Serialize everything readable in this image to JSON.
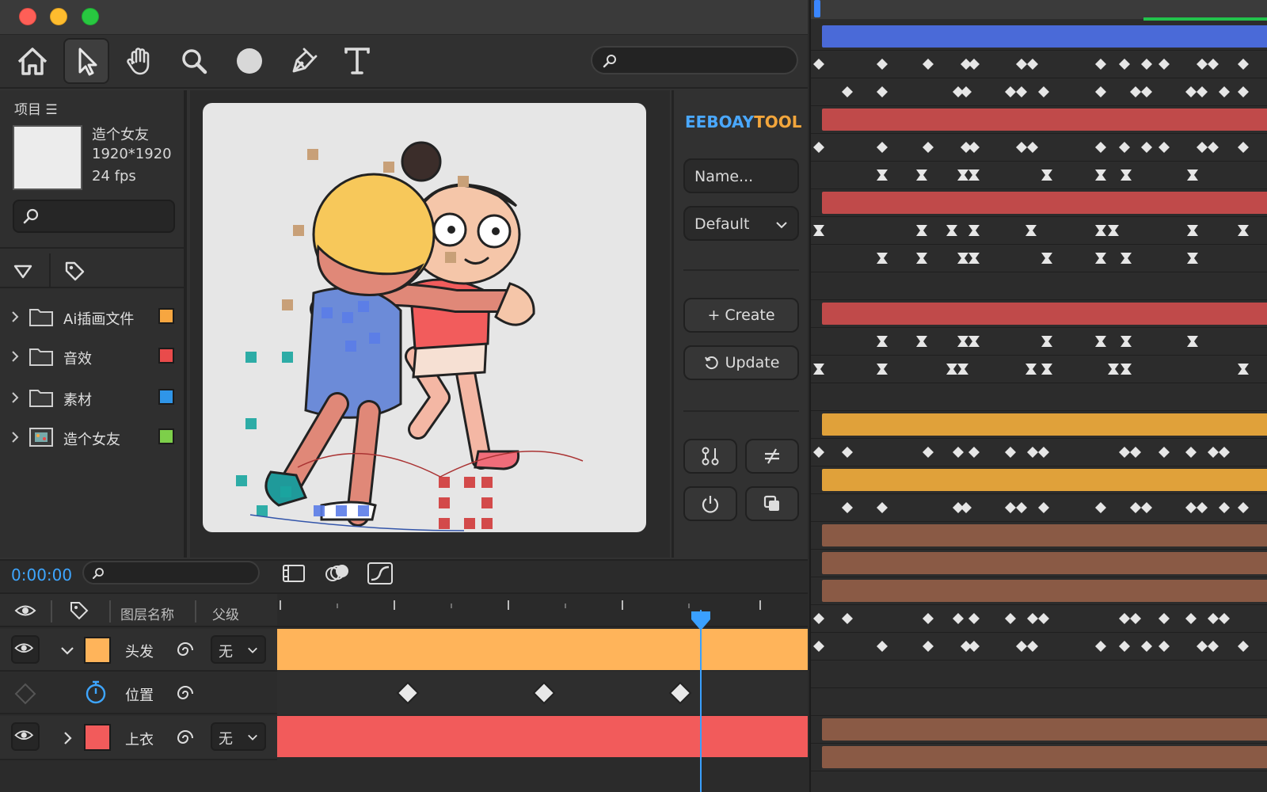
{
  "window": {
    "traffic_lights": {
      "close": "#fe5f57",
      "minimize": "#febc2e",
      "maximize": "#28c840"
    }
  },
  "toolbar": {
    "tools": [
      "home-icon",
      "selection-arrow-icon",
      "hand-icon",
      "zoom-icon",
      "ellipse-icon",
      "pen-icon",
      "text-icon"
    ],
    "active_tool": "selection-arrow-icon",
    "search_placeholder": ""
  },
  "project": {
    "header": "项目 ☰",
    "comp_name": "造个女友",
    "comp_size": "1920*1920",
    "comp_fps": "24 fps",
    "search_placeholder": "",
    "items": [
      {
        "label": "Ai插画文件",
        "color": "#f7a640",
        "type": "folder"
      },
      {
        "label": "音效",
        "color": "#e94b4b",
        "type": "folder"
      },
      {
        "label": "素材",
        "color": "#2f95e8",
        "type": "folder"
      },
      {
        "label": "造个女友",
        "color": "#7dcf4a",
        "type": "composition"
      }
    ]
  },
  "tool_panel": {
    "brand_part1": "EEBOAY",
    "brand_part2": "TOOL",
    "name_placeholder": "Name...",
    "preset": "Default",
    "create_label": "+ Create",
    "update_label": "Update"
  },
  "timeline": {
    "time": "0:00:00",
    "search_placeholder": "",
    "col_layer_name": "图层名称",
    "col_parent": "父级",
    "layers": [
      {
        "name": "头发",
        "color": "#ffb45a",
        "parent": "无",
        "expanded": true
      },
      {
        "name": "上衣",
        "color": "#f25b5b",
        "parent": "无",
        "expanded": false
      }
    ],
    "property": {
      "name": "位置"
    }
  },
  "dopesheet": {
    "bar_colors": {
      "blue": "#4a6ad8",
      "red": "#c04a4a",
      "orange": "#e0a13a",
      "brown": "#8a5a45"
    },
    "rows": [
      "blue",
      "marks",
      "marks",
      "red",
      "marks",
      "hourglass",
      "red",
      "hourglass",
      "hourglass",
      "empty",
      "red",
      "hourglass",
      "hourglass",
      "empty",
      "orange",
      "marks",
      "orange",
      "marks",
      "brown",
      "brown",
      "brown",
      "marks",
      "marks",
      "empty",
      "empty",
      "brown",
      "brown"
    ]
  }
}
